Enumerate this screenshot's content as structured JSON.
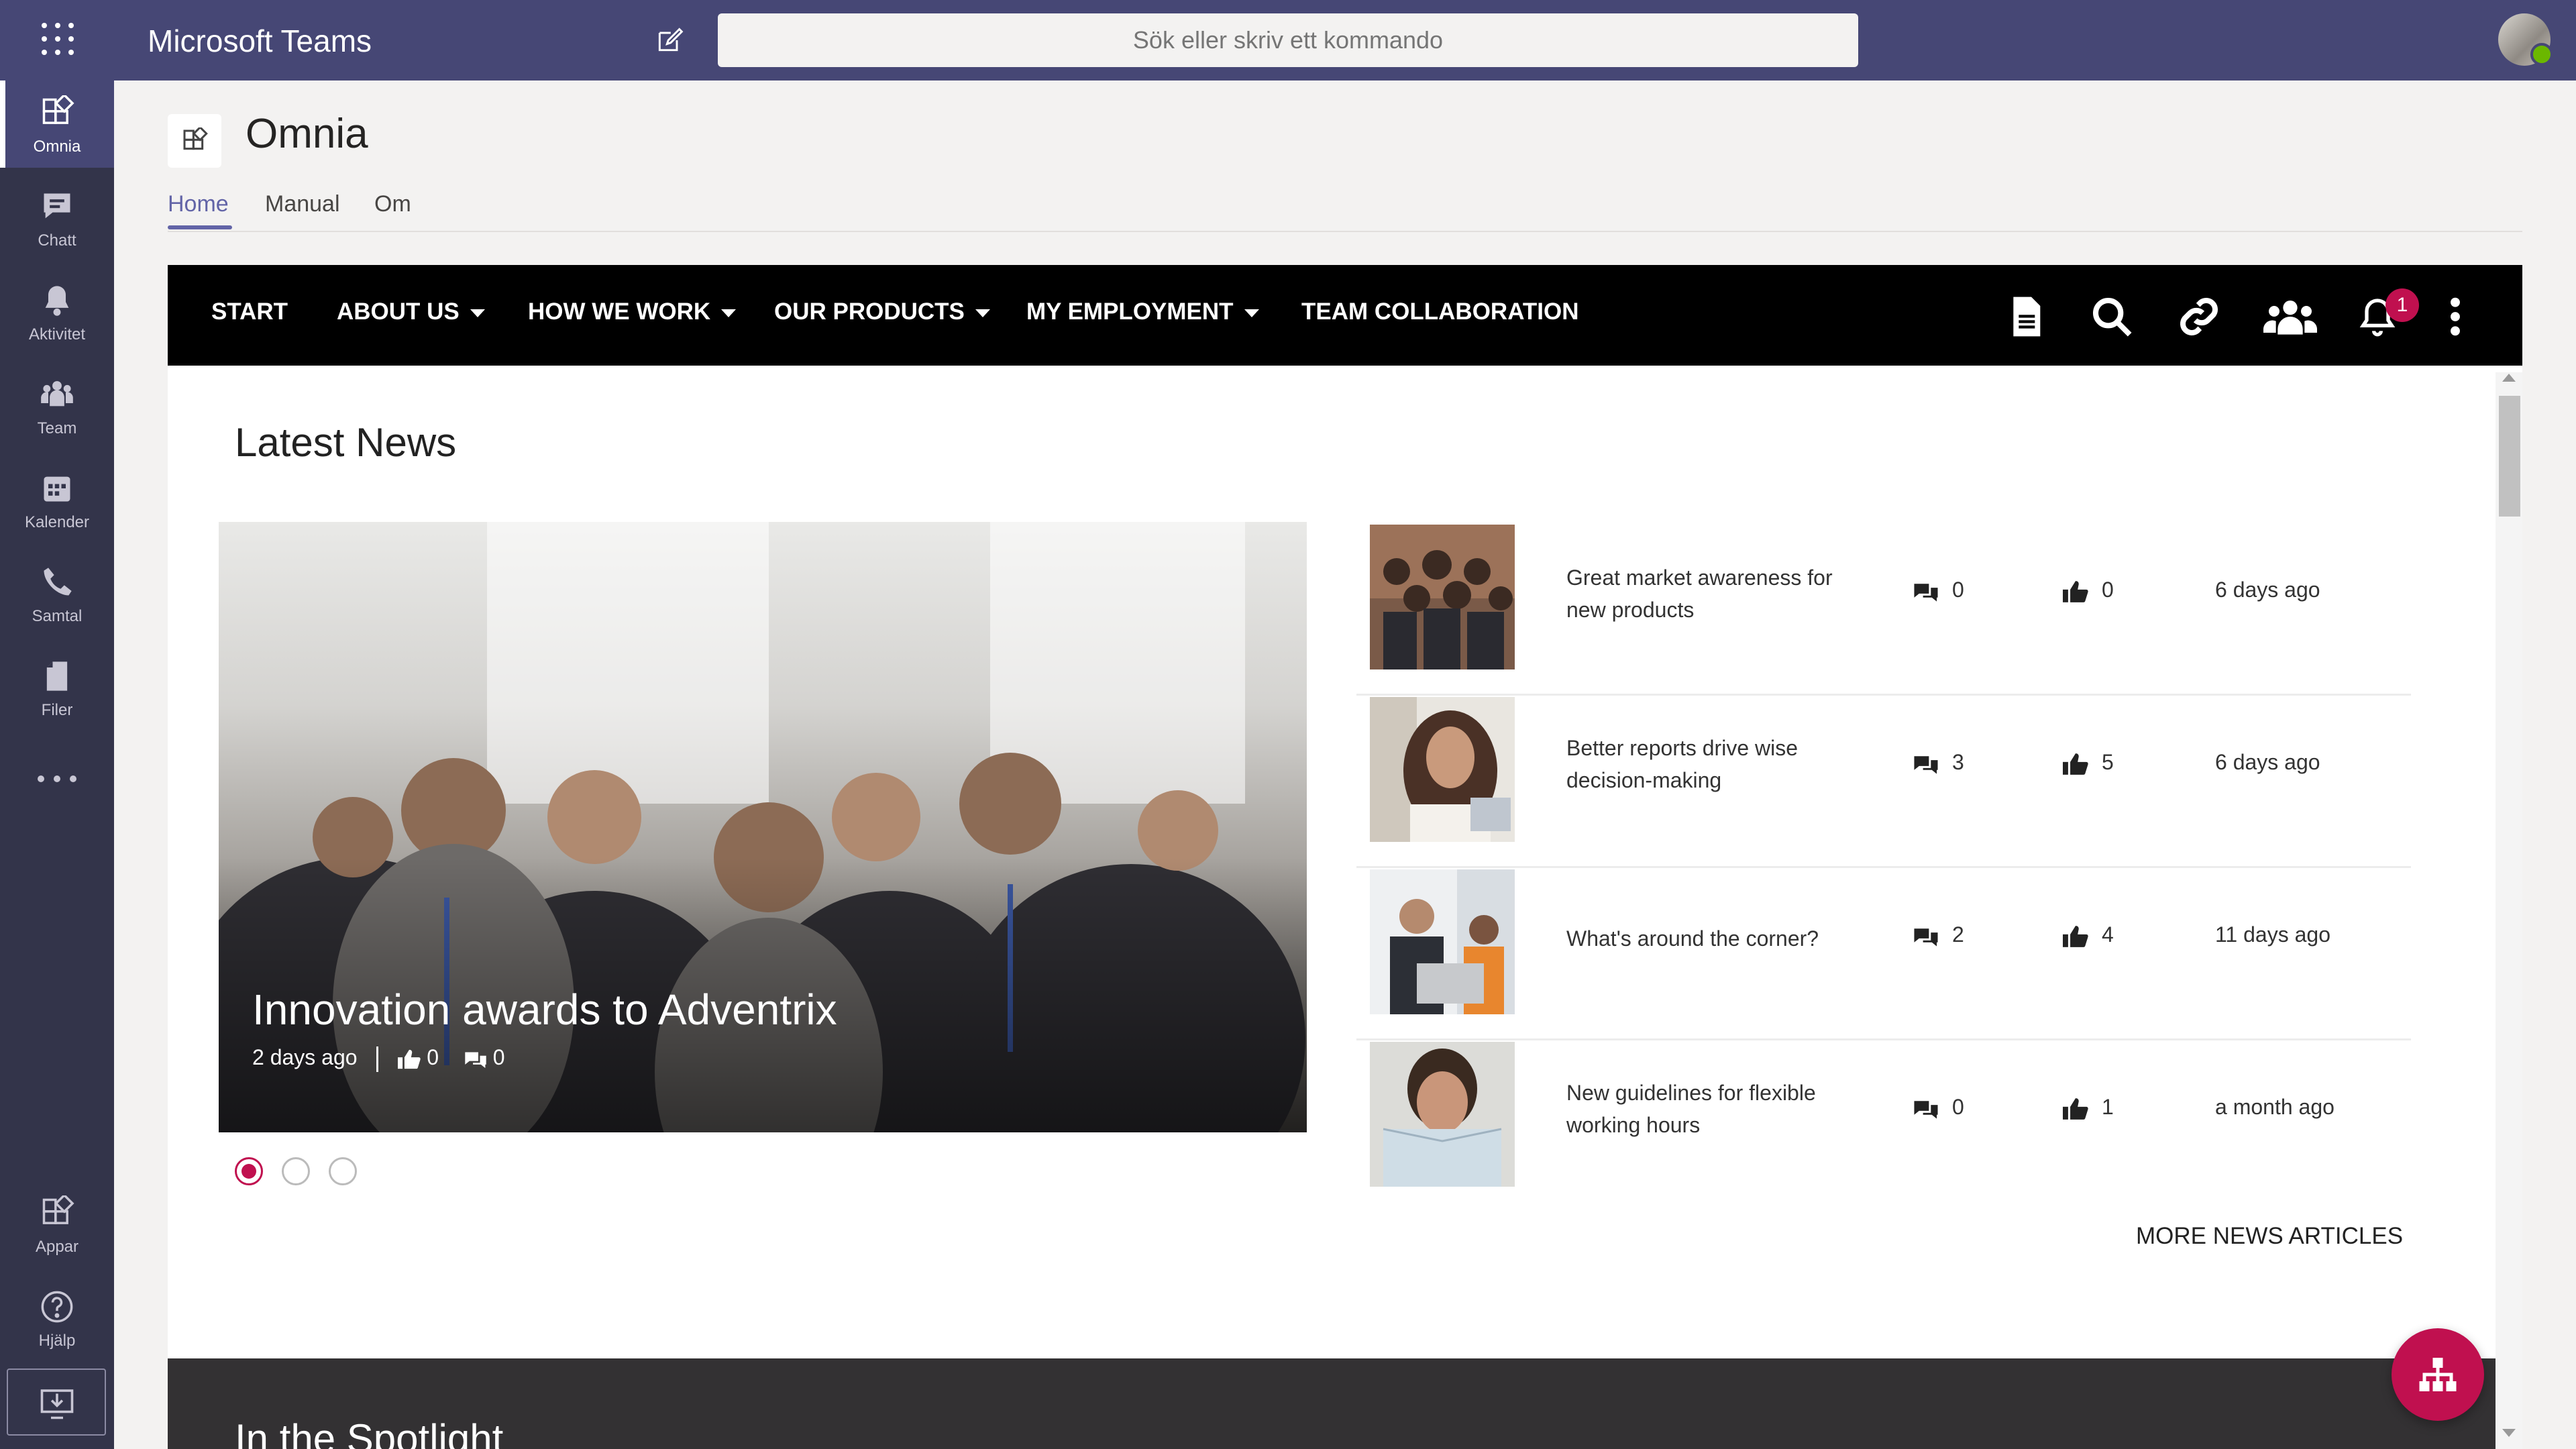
{
  "app": {
    "title": "Microsoft Teams",
    "search_placeholder": "Sök eller skriv ett kommando"
  },
  "rail": {
    "items": [
      {
        "label": "Omnia",
        "icon": "apps-icon"
      },
      {
        "label": "Chatt",
        "icon": "chat-icon"
      },
      {
        "label": "Aktivitet",
        "icon": "bell-icon"
      },
      {
        "label": "Team",
        "icon": "team-icon"
      },
      {
        "label": "Kalender",
        "icon": "calendar-icon"
      },
      {
        "label": "Samtal",
        "icon": "phone-icon"
      },
      {
        "label": "Filer",
        "icon": "file-icon"
      }
    ],
    "bottom": [
      {
        "label": "Appar",
        "icon": "apps-icon"
      },
      {
        "label": "Hjälp",
        "icon": "help-icon"
      }
    ]
  },
  "channel": {
    "title": "Omnia",
    "tabs": [
      {
        "label": "Home"
      },
      {
        "label": "Manual"
      },
      {
        "label": "Om"
      }
    ]
  },
  "navbar": {
    "items": [
      {
        "label": "START"
      },
      {
        "label": "ABOUT US"
      },
      {
        "label": "HOW WE WORK"
      },
      {
        "label": "OUR PRODUCTS"
      },
      {
        "label": "MY EMPLOYMENT"
      },
      {
        "label": "TEAM COLLABORATION"
      }
    ],
    "notification_count": "1"
  },
  "latest_news": {
    "title": "Latest News",
    "featured": {
      "title": "Innovation awards to Adventrix",
      "date": "2 days ago",
      "likes": "0",
      "comments": "0"
    },
    "articles": [
      {
        "title": "Great market awareness for new products",
        "comments": "0",
        "likes": "0",
        "date": "6 days ago"
      },
      {
        "title": "Better reports drive wise decision-making",
        "comments": "3",
        "likes": "5",
        "date": "6 days ago"
      },
      {
        "title": "What's around the corner?",
        "comments": "2",
        "likes": "4",
        "date": "11 days ago"
      },
      {
        "title": "New guidelines for flexible working hours",
        "comments": "0",
        "likes": "1",
        "date": "a month ago"
      }
    ],
    "more_label": "MORE NEWS ARTICLES"
  },
  "spotlight": {
    "title": "In the Spotlight"
  },
  "colors": {
    "teams_purple": "#464775",
    "rail": "#33344a",
    "accent": "#6264a7",
    "omnia_red": "#c0104f"
  }
}
